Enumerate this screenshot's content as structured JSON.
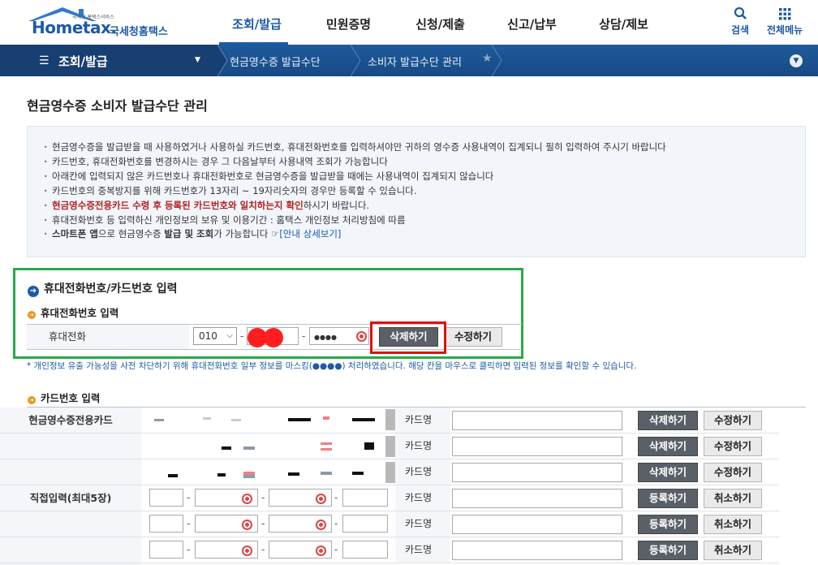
{
  "header": {
    "logo_tagline": "국세청 홈택스서비스",
    "logo_brand": "Hometax.",
    "logo_brand_ko": "국세청홈택스",
    "nav": [
      "조회/발급",
      "민원증명",
      "신청/제출",
      "신고/납부",
      "상담/제보"
    ],
    "search_label": "검색",
    "all_menu_label": "전체메뉴"
  },
  "navbar": {
    "current": "조회/발급",
    "crumb1": "현금영수증 발급수단",
    "crumb2": "소비자 발급수단 관리"
  },
  "page_title": "현금영수증 소비자 발급수단 관리",
  "info": {
    "l1": "현금영수증을 발급받을 때 사용하였거나 사용하실 카드번호, 휴대전화번호를 입력하셔야만 귀하의 영수증 사용내역이 집계되니 필히 입력하여 주시기 바랍니다",
    "l2": "카드번호, 휴대전화번호를 변경하시는 경우 그 다음날부터 사용내역 조회가 가능합니다",
    "l3": "아래칸에 입력되지 않은 카드번호나 휴대전화번호로 현금영수증을 발급받을 때에는 사용내역이 집계되지 않습니다",
    "l4": "카드번호의 중복방지를 위해 카드번호가 13자리 ~ 19자리숫자의 경우만 등록할 수 있습니다.",
    "l5_red": "현금영수증전용카드 수령 후 등록된 카드번호와 일치하는지 확인",
    "l5_tail": "하시기 바랍니다.",
    "l6": "휴대전화번호 등 입력하신 개인정보의 보유 및 이용기간 : 홈택스 개인정보 처리방침에 따름",
    "l7_a": "스마트폰 앱",
    "l7_b": "으로 현금영수증 ",
    "l7_c": "발급 및 조회",
    "l7_d": "가 가능합니다 ",
    "l7_link": "[안내 상세보기]"
  },
  "phone_section": {
    "title": "휴대전화번호/카드번호 입력",
    "subtitle": "휴대전화번호 입력",
    "label": "휴대전화",
    "prefix": "010",
    "last": "●●●●",
    "delete_btn": "삭제하기",
    "edit_btn": "수정하기",
    "mask_note": "* 개인정보 유출 가능성을 사전 차단하기 위해 휴대전화번호 일부 정보를 마스킹(●●●●) 처리하였습니다. 해당 칸을 마우스로 클릭하면 입력된 정보를 확인할 수 있습니다."
  },
  "card_section": {
    "subtitle": "카드번호 입력",
    "exclusive_label": "현금영수증전용카드",
    "direct_label": "직접입력(최대5장)",
    "card_name_label": "카드명",
    "delete_btn": "삭제하기",
    "edit_btn": "수정하기",
    "register_btn": "등록하기",
    "cancel_btn": "취소하기"
  }
}
